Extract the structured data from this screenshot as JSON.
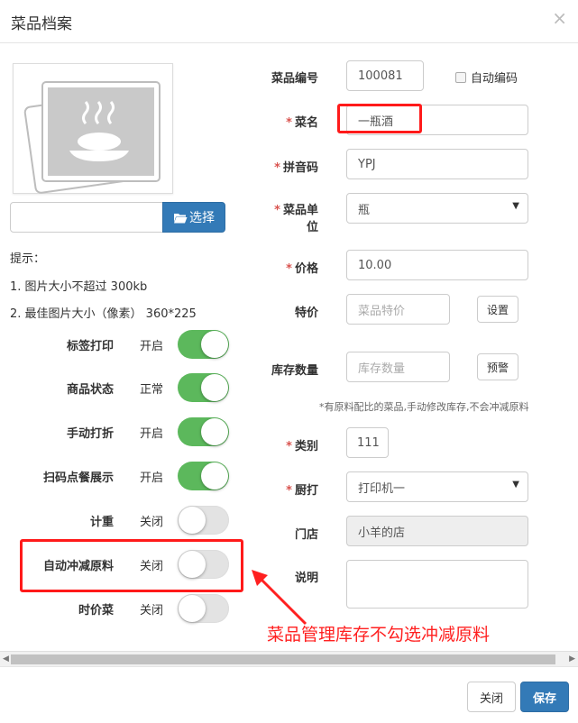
{
  "dialog": {
    "title": "菜品档案",
    "close_glyph": "×"
  },
  "image": {
    "icon": "food-plate-placeholder-icon"
  },
  "upload": {
    "file_value": "",
    "select_label": "选择",
    "icon": "folder-open-icon"
  },
  "tips": {
    "heading": "提示：",
    "line1": "1. 图片大小不超过 300kb",
    "line2": "2. 最佳图片大小（像素） 360*225"
  },
  "toggles": [
    {
      "label": "标签打印",
      "state": "开启",
      "on": true
    },
    {
      "label": "商品状态",
      "state": "正常",
      "on": true
    },
    {
      "label": "手动打折",
      "state": "开启",
      "on": true
    },
    {
      "label": "扫码点餐展示",
      "state": "开启",
      "on": true
    },
    {
      "label": "计重",
      "state": "关闭",
      "on": false
    },
    {
      "label": "自动冲减原料",
      "state": "关闭",
      "on": false
    },
    {
      "label": "时价菜",
      "state": "关闭",
      "on": false
    }
  ],
  "form": {
    "code": {
      "label": "菜品编号",
      "value": "100081"
    },
    "autocode": {
      "label": "自动编码",
      "checked": false
    },
    "name": {
      "label": "菜名",
      "value": "一瓶酒"
    },
    "pinyin": {
      "label": "拼音码",
      "value": "YPJ"
    },
    "unit": {
      "label_line1": "菜品单",
      "label_line2": "位",
      "value": "瓶"
    },
    "price": {
      "label": "价格",
      "value": "10.00"
    },
    "special": {
      "label": "特价",
      "placeholder": "菜品特价",
      "button": "设置"
    },
    "stock": {
      "label": "库存数量",
      "placeholder": "库存数量",
      "button": "预警"
    },
    "stock_note": "*有原料配比的菜品,手动修改库存,不会冲减原料",
    "category": {
      "label": "类别",
      "value": "111"
    },
    "kitchen": {
      "label": "厨打",
      "value": "打印机一"
    },
    "store": {
      "label": "门店",
      "value": "小羊的店"
    },
    "remark": {
      "label": "说明",
      "value": ""
    }
  },
  "annotation": {
    "text": "菜品管理库存不勾选冲减原料",
    "color": "#ff2020"
  },
  "footer": {
    "close_label": "关闭",
    "save_label": "保存"
  },
  "colors": {
    "primary": "#337ab7",
    "switch_on": "#5cb85c",
    "required": "#d9534f",
    "highlight": "#ff1a1a"
  }
}
